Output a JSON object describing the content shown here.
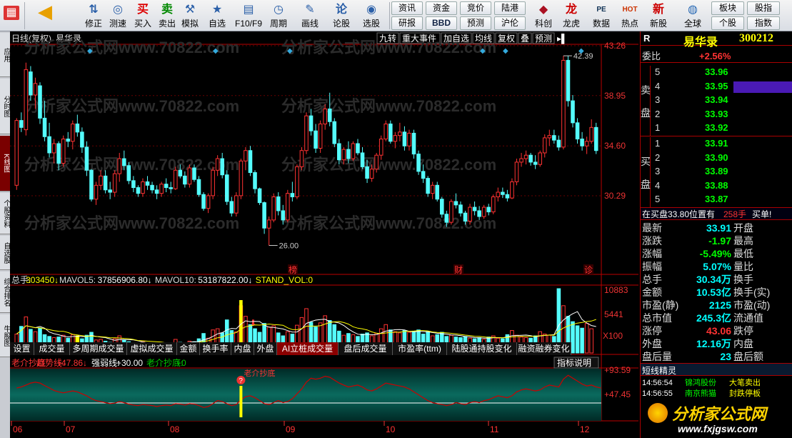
{
  "toolbar": {
    "buttons": [
      {
        "name": "back-button",
        "icon": "◀",
        "label": ""
      },
      {
        "name": "up-down-button",
        "icon": "⇅",
        "label": "修正"
      },
      {
        "name": "rule-button",
        "icon": "◎",
        "label": "测速"
      },
      {
        "name": "buy-button",
        "icon": "买",
        "label": "买入"
      },
      {
        "name": "sell-button",
        "icon": "卖",
        "label": "卖出"
      },
      {
        "name": "simulate-button",
        "icon": "⚒",
        "label": "模拟"
      },
      {
        "name": "favorites-button",
        "icon": "★",
        "label": "自选"
      },
      {
        "name": "f10-button",
        "icon": "▤",
        "label": "F10/F9"
      },
      {
        "name": "period-button",
        "icon": "◷",
        "label": "周期"
      },
      {
        "name": "draw-button",
        "icon": "✎",
        "label": "画线"
      },
      {
        "name": "lungu-button",
        "icon": "论",
        "label": "论股"
      },
      {
        "name": "select-stock-button",
        "icon": "◉",
        "label": "选股"
      }
    ],
    "grid_buttons": [
      [
        "资讯",
        "资金",
        "竞价",
        "陆港"
      ],
      [
        "研报",
        "BBD",
        "预测",
        "沪伦"
      ]
    ],
    "right_buttons": [
      {
        "name": "kechuang-button",
        "icon": "◆",
        "label": "科创"
      },
      {
        "name": "dragon-tiger-button",
        "icon": "龙",
        "label": "龙虎"
      },
      {
        "name": "data-button",
        "icon": "PE",
        "label": "数据"
      },
      {
        "name": "hotspot-button",
        "icon": "HOT",
        "label": "热点"
      },
      {
        "name": "new-stock-button",
        "icon": "新",
        "label": "新股"
      },
      {
        "name": "global-button",
        "icon": "◍",
        "label": "全球"
      }
    ],
    "far_right": [
      [
        "板块",
        "股指"
      ],
      [
        "个股",
        "指数"
      ]
    ]
  },
  "left_tabs": [
    "应用",
    "分时图",
    "K线图",
    "个股资料",
    "自选股",
    "综合排名",
    "牛股图"
  ],
  "chart": {
    "header_left": "日线(复权)",
    "stock_name": "易华录",
    "header_buttons": [
      "九转",
      "重大事件",
      "加自选",
      "均线",
      "复权",
      "叠",
      "预测"
    ],
    "watermark": "分析家公式网www.70822.com",
    "price_labels": [
      "43.26",
      "38.95",
      "34.60",
      "30.29"
    ],
    "high_mark": "42.39",
    "low_mark": "26.00",
    "event_marks": [
      "榜",
      "财",
      "诊"
    ],
    "volume_line": {
      "prefix": "总手:",
      "total": "303450",
      "mavol5_label": "MAVOL5:",
      "mavol5": "37856906.80",
      "mavol10_label": "MAVOL10:",
      "mavol10": "53187822.00",
      "stand_label": "STAND_VOL:",
      "stand": "0"
    },
    "volume_axis": [
      "10883",
      "5441",
      "X100"
    ],
    "tabs": [
      "设置",
      "成交量",
      "多周期成交量",
      "虚拟成交量",
      "金额",
      "换手率",
      "内盘",
      "外盘",
      "AI立桩成交量",
      "盘后成交量",
      "市盈率(ttm)",
      "陆股通持股变化",
      "融资融券变化"
    ],
    "active_tab": "AI立桩成交量",
    "indicator_line": {
      "name": "老介抄底",
      "trend_label": "趋势线:",
      "trend": "+47.86",
      "strength_label": "强弱线:",
      "strength": "+30.00",
      "bottom_label": "老介抄底:",
      "bottom": "+0"
    },
    "indicator_note": "老介抄底",
    "indicator_btn": "指标说明",
    "indicator_axis": [
      "+93.59",
      "+47.45"
    ],
    "months": [
      "06",
      "07",
      "08",
      "09",
      "10",
      "11",
      "12"
    ]
  },
  "chart_data": {
    "type": "candlestick",
    "title": "日线(复权) 易华录",
    "ylim": [
      23.5,
      43.26
    ],
    "candles": [
      [
        31.2,
        37.0,
        30.8,
        36.8
      ],
      [
        36.8,
        37.5,
        35.8,
        36.2
      ],
      [
        36.0,
        41.8,
        35.5,
        41.2
      ],
      [
        41.0,
        41.5,
        38.5,
        39.0
      ],
      [
        39.0,
        40.5,
        37.8,
        40.0
      ],
      [
        39.8,
        40.1,
        36.5,
        37.0
      ],
      [
        37.0,
        38.5,
        35.0,
        35.4
      ],
      [
        35.4,
        36.6,
        33.6,
        34.0
      ],
      [
        34.0,
        35.2,
        33.1,
        34.8
      ],
      [
        34.8,
        35.0,
        32.5,
        33.1
      ],
      [
        33.1,
        35.5,
        32.8,
        35.2
      ],
      [
        35.2,
        35.8,
        34.5,
        35.0
      ],
      [
        35.0,
        36.8,
        34.3,
        36.5
      ],
      [
        36.5,
        37.3,
        35.4,
        35.8
      ],
      [
        35.8,
        36.2,
        34.0,
        34.5
      ],
      [
        34.5,
        35.0,
        32.0,
        32.5
      ],
      [
        32.5,
        32.6,
        29.8,
        30.0
      ],
      [
        30.0,
        31.5,
        29.5,
        31.2
      ],
      [
        31.2,
        32.5,
        30.8,
        32.0
      ],
      [
        32.0,
        32.5,
        30.5,
        30.8
      ],
      [
        30.8,
        31.5,
        30.0,
        30.6
      ],
      [
        30.6,
        32.5,
        30.2,
        32.2
      ],
      [
        32.2,
        34.0,
        31.5,
        33.5
      ],
      [
        33.5,
        34.2,
        32.5,
        32.9
      ],
      [
        32.9,
        33.2,
        31.3,
        31.6
      ],
      [
        31.6,
        32.0,
        30.6,
        31.0
      ],
      [
        31.0,
        31.2,
        30.2,
        30.5
      ],
      [
        30.5,
        31.8,
        30.2,
        31.5
      ],
      [
        31.5,
        32.0,
        30.8,
        31.2
      ],
      [
        31.2,
        31.5,
        30.5,
        30.8
      ],
      [
        30.8,
        31.2,
        30.0,
        30.5
      ],
      [
        30.5,
        31.5,
        30.2,
        31.3
      ],
      [
        31.3,
        31.8,
        30.6,
        31.0
      ],
      [
        31.0,
        31.5,
        30.5,
        30.9
      ],
      [
        30.9,
        32.8,
        30.8,
        32.5
      ],
      [
        32.5,
        33.0,
        31.8,
        32.0
      ],
      [
        32.0,
        32.4,
        31.0,
        31.3
      ],
      [
        31.3,
        33.0,
        31.0,
        32.7
      ],
      [
        32.7,
        33.0,
        31.5,
        31.7
      ],
      [
        31.7,
        32.0,
        30.2,
        30.4
      ],
      [
        30.4,
        30.6,
        29.0,
        29.2
      ],
      [
        29.2,
        30.5,
        28.8,
        30.3
      ],
      [
        30.3,
        32.8,
        30.0,
        32.5
      ],
      [
        32.5,
        33.8,
        32.0,
        33.5
      ],
      [
        33.5,
        34.0,
        31.8,
        32.1
      ],
      [
        32.1,
        32.5,
        29.5,
        29.8
      ],
      [
        29.8,
        30.2,
        28.5,
        28.8
      ],
      [
        28.8,
        30.6,
        28.5,
        30.3
      ],
      [
        30.3,
        33.5,
        30.0,
        33.3
      ],
      [
        33.3,
        34.5,
        32.5,
        34.2
      ],
      [
        34.2,
        34.6,
        32.0,
        32.3
      ],
      [
        32.3,
        32.5,
        30.5,
        30.9
      ],
      [
        30.9,
        31.0,
        29.5,
        29.7
      ],
      [
        29.7,
        29.8,
        27.0,
        27.5
      ],
      [
        27.5,
        28.5,
        26.0,
        28.2
      ],
      [
        28.2,
        30.5,
        28.0,
        30.2
      ],
      [
        30.2,
        30.6,
        28.6,
        29.0
      ],
      [
        29.0,
        29.5,
        27.8,
        28.2
      ],
      [
        28.2,
        30.8,
        28.0,
        30.5
      ],
      [
        30.5,
        31.5,
        29.8,
        30.2
      ],
      [
        30.2,
        33.0,
        30.0,
        32.8
      ],
      [
        32.8,
        34.5,
        32.5,
        34.2
      ],
      [
        34.2,
        37.5,
        33.9,
        37.2
      ],
      [
        37.2,
        37.8,
        35.5,
        35.9
      ],
      [
        35.9,
        36.5,
        34.0,
        34.4
      ],
      [
        34.4,
        36.8,
        34.0,
        36.5
      ],
      [
        36.5,
        38.2,
        36.0,
        37.8
      ],
      [
        37.8,
        39.2,
        36.3,
        36.7
      ],
      [
        36.7,
        37.0,
        34.5,
        34.8
      ],
      [
        34.8,
        35.2,
        33.0,
        33.4
      ],
      [
        33.4,
        34.5,
        33.0,
        34.3
      ],
      [
        34.3,
        35.0,
        33.1,
        33.5
      ],
      [
        33.5,
        35.0,
        33.3,
        34.8
      ],
      [
        34.8,
        35.2,
        33.8,
        34.0
      ],
      [
        34.0,
        34.5,
        32.6,
        32.8
      ],
      [
        32.8,
        33.4,
        31.4,
        31.8
      ],
      [
        31.8,
        33.0,
        31.5,
        32.6
      ],
      [
        32.6,
        34.0,
        32.3,
        33.8
      ],
      [
        33.8,
        35.5,
        33.4,
        35.2
      ],
      [
        35.2,
        36.8,
        35.0,
        36.5
      ],
      [
        36.5,
        36.8,
        34.8,
        35.0
      ],
      [
        35.0,
        35.8,
        34.4,
        35.5
      ],
      [
        35.5,
        36.6,
        35.0,
        35.8
      ],
      [
        35.8,
        36.3,
        34.2,
        34.6
      ],
      [
        34.6,
        36.0,
        34.2,
        35.7
      ],
      [
        35.7,
        36.0,
        33.5,
        33.9
      ],
      [
        33.9,
        34.2,
        32.1,
        32.4
      ],
      [
        32.4,
        33.0,
        31.4,
        31.8
      ],
      [
        31.8,
        32.0,
        30.2,
        30.5
      ],
      [
        30.5,
        31.5,
        30.0,
        31.2
      ],
      [
        31.2,
        31.5,
        29.8,
        30.0
      ],
      [
        30.0,
        30.2,
        28.4,
        28.7
      ],
      [
        28.7,
        29.0,
        27.6,
        28.0
      ],
      [
        28.0,
        30.0,
        27.8,
        29.8
      ],
      [
        29.8,
        30.5,
        29.2,
        29.5
      ],
      [
        29.5,
        29.8,
        28.5,
        28.8
      ],
      [
        28.8,
        29.0,
        27.8,
        28.1
      ],
      [
        28.1,
        29.6,
        27.8,
        29.3
      ],
      [
        29.3,
        29.8,
        28.6,
        29.0
      ],
      [
        29.0,
        29.4,
        28.2,
        28.5
      ],
      [
        28.5,
        29.5,
        28.3,
        29.3
      ],
      [
        29.3,
        29.6,
        28.6,
        28.9
      ],
      [
        28.9,
        30.4,
        28.7,
        30.2
      ],
      [
        30.2,
        31.0,
        29.8,
        30.6
      ],
      [
        30.6,
        31.0,
        30.1,
        30.4
      ],
      [
        30.4,
        30.8,
        29.8,
        30.1
      ],
      [
        30.1,
        31.8,
        30.0,
        31.5
      ],
      [
        31.5,
        33.5,
        31.2,
        33.2
      ],
      [
        33.2,
        34.0,
        32.8,
        33.5
      ],
      [
        33.5,
        34.2,
        33.0,
        33.8
      ],
      [
        33.8,
        34.0,
        32.9,
        33.2
      ],
      [
        33.2,
        33.8,
        32.6,
        33.0
      ],
      [
        33.0,
        34.2,
        32.8,
        34.0
      ],
      [
        34.0,
        35.6,
        33.6,
        35.3
      ],
      [
        35.3,
        36.0,
        34.6,
        35.5
      ],
      [
        35.5,
        36.0,
        34.8,
        35.1
      ],
      [
        35.1,
        35.5,
        34.2,
        34.5
      ],
      [
        34.5,
        42.39,
        34.3,
        42.0
      ],
      [
        42.0,
        42.39,
        38.0,
        38.5
      ],
      [
        38.5,
        39.0,
        36.2,
        36.6
      ],
      [
        36.6,
        37.0,
        34.8,
        35.2
      ],
      [
        35.2,
        35.8,
        34.2,
        34.6
      ],
      [
        34.6,
        35.4,
        33.9,
        35.0
      ],
      [
        35.0,
        36.9,
        34.8,
        36.2
      ],
      [
        36.2,
        36.6,
        33.9,
        34.2
      ]
    ],
    "volume": [
      3.2,
      4.5,
      6.1,
      4.0,
      3.6,
      4.2,
      3.1,
      2.8,
      2.6,
      2.7,
      3.0,
      2.5,
      3.1,
      2.9,
      2.4,
      3.0,
      3.5,
      2.2,
      2.3,
      2.0,
      1.8,
      2.4,
      2.9,
      2.2,
      1.9,
      1.7,
      1.6,
      1.9,
      1.5,
      1.6,
      1.4,
      1.7,
      1.5,
      1.4,
      2.3,
      1.8,
      1.5,
      2.0,
      1.9,
      2.4,
      3.3,
      2.5,
      3.9,
      4.1,
      3.4,
      5.6,
      3.8,
      3.6,
      8.0,
      6.2,
      4.8,
      4.1,
      3.5,
      5.0,
      4.4,
      4.6,
      3.4,
      2.9,
      3.6,
      3.2,
      4.7,
      6.0,
      7.5,
      5.2,
      4.4,
      5.1,
      6.3,
      5.5,
      4.8,
      3.7,
      3.0,
      3.3,
      3.1,
      2.8,
      3.2,
      3.4,
      2.9,
      3.3,
      4.1,
      4.8,
      3.9,
      3.6,
      3.4,
      3.8,
      3.5,
      3.7,
      3.9,
      3.2,
      3.6,
      2.9,
      3.1,
      3.5,
      2.8,
      3.0,
      2.7,
      2.6,
      2.8,
      2.5,
      2.4,
      2.6,
      2.3,
      2.7,
      2.9,
      2.5,
      2.4,
      3.1,
      3.8,
      3.0,
      2.7,
      2.6,
      2.5,
      2.9,
      3.6,
      3.2,
      3.0,
      2.8,
      10.88,
      8.0,
      6.2,
      5.3,
      4.6,
      4.2,
      5.0,
      4.1
    ],
    "trend_line": [
      60,
      62,
      66,
      70,
      72,
      70,
      65,
      60,
      55,
      52,
      50,
      52,
      54,
      52,
      48,
      44,
      38,
      34,
      32,
      30,
      28,
      29,
      32,
      30,
      27,
      25,
      24,
      26,
      25,
      24,
      22,
      24,
      25,
      24,
      28,
      27,
      25,
      28,
      27,
      24,
      20,
      22,
      28,
      34,
      32,
      28,
      24,
      26,
      36,
      42,
      44,
      40,
      34,
      28,
      26,
      30,
      34,
      30,
      32,
      38,
      48,
      58,
      72,
      80,
      78,
      80,
      84,
      82,
      76,
      70,
      66,
      62,
      64,
      66,
      62,
      56,
      54,
      58,
      64,
      70,
      68,
      66,
      64,
      62,
      58,
      52,
      46,
      40,
      34,
      30,
      28,
      26,
      24,
      26,
      30,
      28,
      26,
      30,
      32,
      30,
      34,
      36,
      40,
      44,
      42,
      40,
      44,
      52,
      56,
      58,
      56,
      54,
      56,
      62,
      66,
      64,
      62,
      78,
      86,
      80,
      74,
      68,
      64,
      66,
      62,
      60
    ],
    "volume_max": 10883
  }
}
